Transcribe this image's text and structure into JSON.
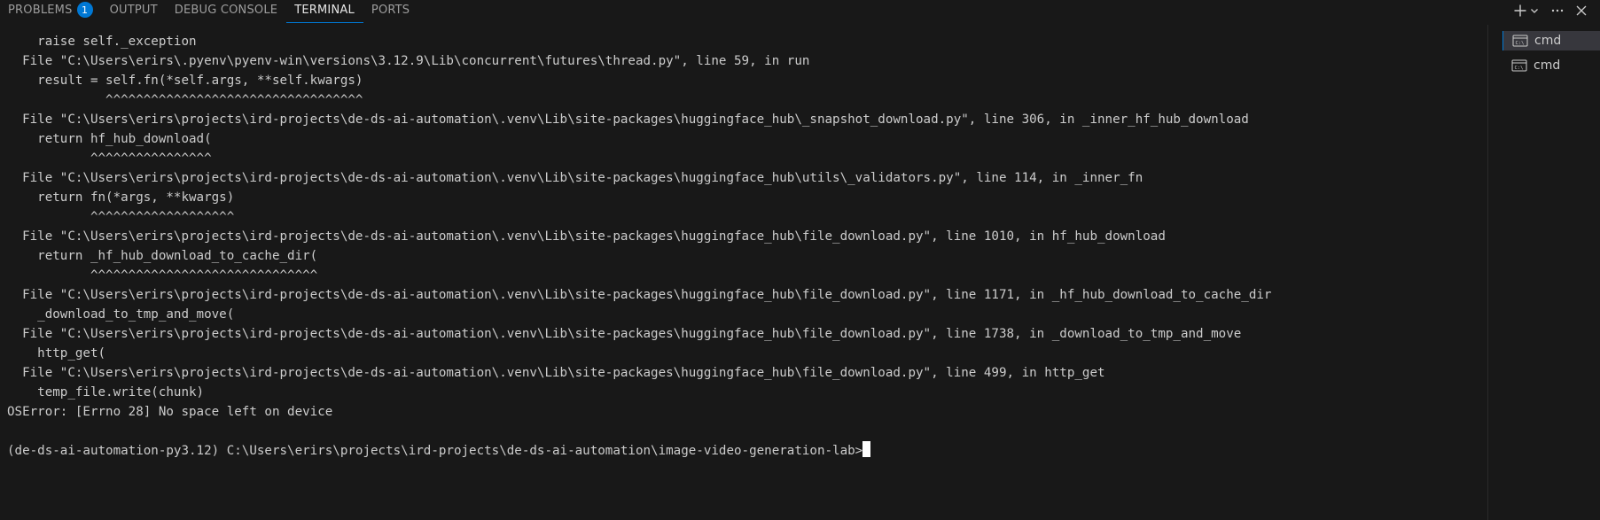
{
  "tabs": {
    "problems_label": "PROBLEMS",
    "problems_count": "1",
    "output_label": "OUTPUT",
    "debug_label": "DEBUG CONSOLE",
    "terminal_label": "TERMINAL",
    "ports_label": "PORTS"
  },
  "toolbar": {
    "new_terminal_icon": "plus-icon",
    "dropdown_icon": "chevron-down-icon",
    "more_icon": "ellipsis-icon",
    "close_icon": "close-icon"
  },
  "terminal_lines": [
    "    raise self._exception",
    "  File \"C:\\Users\\erirs\\.pyenv\\pyenv-win\\versions\\3.12.9\\Lib\\concurrent\\futures\\thread.py\", line 59, in run",
    "    result = self.fn(*self.args, **self.kwargs)",
    "             ^^^^^^^^^^^^^^^^^^^^^^^^^^^^^^^^^^",
    "  File \"C:\\Users\\erirs\\projects\\ird-projects\\de-ds-ai-automation\\.venv\\Lib\\site-packages\\huggingface_hub\\_snapshot_download.py\", line 306, in _inner_hf_hub_download",
    "    return hf_hub_download(",
    "           ^^^^^^^^^^^^^^^^",
    "  File \"C:\\Users\\erirs\\projects\\ird-projects\\de-ds-ai-automation\\.venv\\Lib\\site-packages\\huggingface_hub\\utils\\_validators.py\", line 114, in _inner_fn",
    "    return fn(*args, **kwargs)",
    "           ^^^^^^^^^^^^^^^^^^^",
    "  File \"C:\\Users\\erirs\\projects\\ird-projects\\de-ds-ai-automation\\.venv\\Lib\\site-packages\\huggingface_hub\\file_download.py\", line 1010, in hf_hub_download",
    "    return _hf_hub_download_to_cache_dir(",
    "           ^^^^^^^^^^^^^^^^^^^^^^^^^^^^^^",
    "  File \"C:\\Users\\erirs\\projects\\ird-projects\\de-ds-ai-automation\\.venv\\Lib\\site-packages\\huggingface_hub\\file_download.py\", line 1171, in _hf_hub_download_to_cache_dir",
    "    _download_to_tmp_and_move(",
    "  File \"C:\\Users\\erirs\\projects\\ird-projects\\de-ds-ai-automation\\.venv\\Lib\\site-packages\\huggingface_hub\\file_download.py\", line 1738, in _download_to_tmp_and_move",
    "    http_get(",
    "  File \"C:\\Users\\erirs\\projects\\ird-projects\\de-ds-ai-automation\\.venv\\Lib\\site-packages\\huggingface_hub\\file_download.py\", line 499, in http_get",
    "    temp_file.write(chunk)",
    "OSError: [Errno 28] No space left on device",
    "",
    "(de-ds-ai-automation-py3.12) C:\\Users\\erirs\\projects\\ird-projects\\de-ds-ai-automation\\image-video-generation-lab>"
  ],
  "side_panel": {
    "items": [
      {
        "label": "cmd",
        "icon": "terminal-icon",
        "selected": true
      },
      {
        "label": "cmd",
        "icon": "terminal-icon",
        "selected": false
      }
    ]
  },
  "colors": {
    "background": "#181818",
    "accent": "#0078d4",
    "text": "#cccccc"
  }
}
